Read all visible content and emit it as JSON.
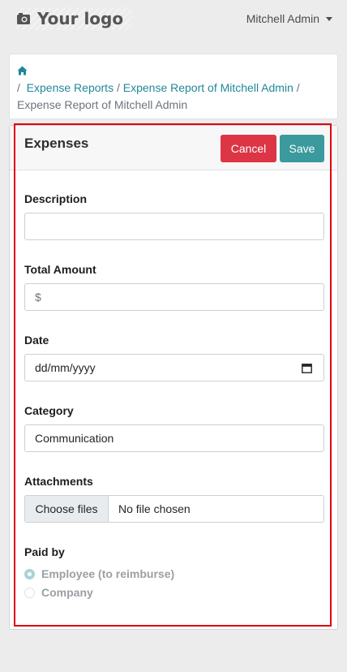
{
  "header": {
    "logo_text": "Your logo",
    "user_name": "Mitchell Admin"
  },
  "breadcrumb": {
    "separator": "/",
    "items": [
      {
        "label": "Expense Reports"
      },
      {
        "label": "Expense Report of Mitchell Admin"
      },
      {
        "label": "Expense Report of Mitchell Admin"
      }
    ]
  },
  "form": {
    "title": "Expenses",
    "cancel_label": "Cancel",
    "save_label": "Save",
    "description": {
      "label": "Description",
      "value": ""
    },
    "total_amount": {
      "label": "Total Amount",
      "placeholder": "$"
    },
    "date": {
      "label": "Date",
      "placeholder": "dd/mm/yyyy"
    },
    "category": {
      "label": "Category",
      "value": "Communication"
    },
    "attachments": {
      "label": "Attachments",
      "button_label": "Choose files",
      "status": "No file chosen"
    },
    "paid_by": {
      "label": "Paid by",
      "options": [
        {
          "label": "Employee (to reimburse)",
          "checked": true
        },
        {
          "label": "Company",
          "checked": false
        }
      ]
    }
  },
  "colors": {
    "accent": "#21879a",
    "cancel": "#dc3545",
    "save": "#3a9a9e",
    "highlight": "#e0000f"
  }
}
